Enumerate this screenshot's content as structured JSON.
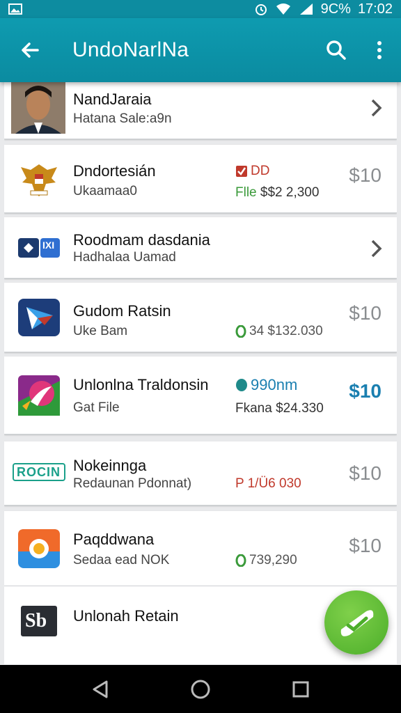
{
  "status_bar": {
    "battery_text": "9C%",
    "time": "17:02"
  },
  "app_bar": {
    "title": "UndoNarlNa"
  },
  "items": [
    {
      "name": "NandJaraia",
      "sub": "Hatana Sale:a9n"
    },
    {
      "name": "Dndortesián",
      "sub": "Ukaamaa0",
      "badge": "DD",
      "extra_label": "Flle",
      "extra_value": "$$2 2,300",
      "price": "$10"
    },
    {
      "name": "Roodmam dasdania",
      "sub": "Hadhalaa Uamad",
      "icon_text": "IXI"
    },
    {
      "name": "Gudom Ratsin",
      "sub": "Uke Bam",
      "badge": "34 $132.030",
      "price": "$10"
    },
    {
      "name": "Unlonlna Traldonsin",
      "sub": "Gat File",
      "badge": "990nm",
      "extra_value": "Fkana $24.330",
      "price": "$10"
    },
    {
      "name": "Nokeinnga",
      "sub": "Redaunan Pdonnat)",
      "badge": "P 1/Ü6 030",
      "price": "$10",
      "icon_text": "ROCIN"
    },
    {
      "name": "Paqddwana",
      "sub": "Sedaa ead NOK",
      "badge": "739,290",
      "price": "$10"
    },
    {
      "name": "Unlonah Retain",
      "icon_text": "Sb"
    }
  ],
  "colors": {
    "app_bar": "#0e9bb0",
    "fab": "#5cbf36",
    "green": "#3a9a3a",
    "red": "#c0392b",
    "blue": "#1a7fb0"
  }
}
